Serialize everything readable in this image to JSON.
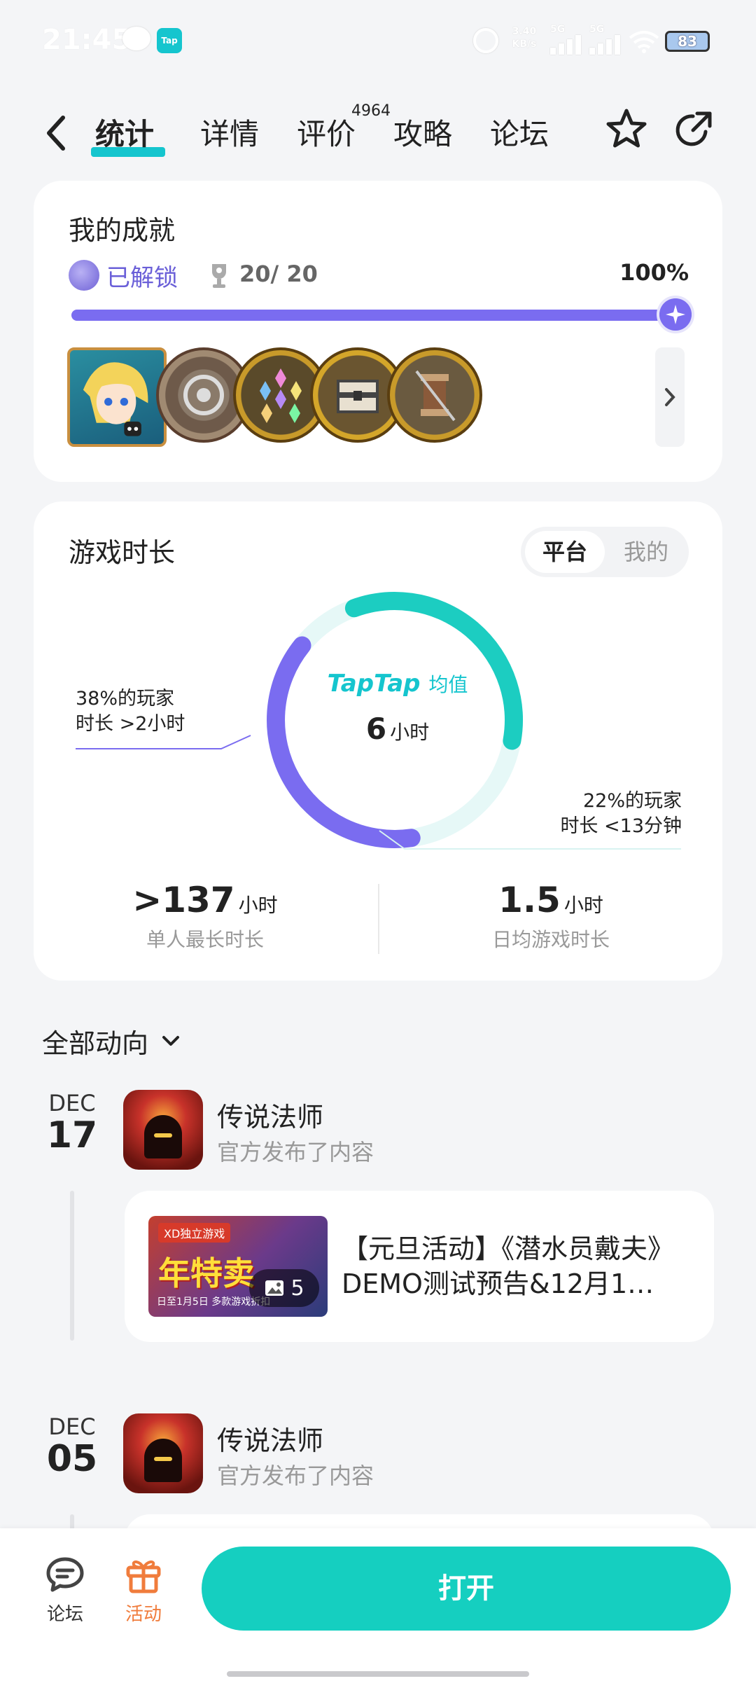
{
  "status_bar": {
    "time": "21:45",
    "tap_label": "Tap",
    "net_speed": "3.40",
    "net_unit": "KB/s",
    "signal1_label": "5G",
    "signal2_label": "5G",
    "battery": "83"
  },
  "nav": {
    "tabs": [
      {
        "label": "统计",
        "active": true
      },
      {
        "label": "详情"
      },
      {
        "label": "评价"
      },
      {
        "label": "攻略"
      },
      {
        "label": "论坛"
      }
    ],
    "review_count": "4964"
  },
  "achievements": {
    "title": "我的成就",
    "status_label": "已解锁",
    "count": "20/ 20",
    "percent_text": "100%",
    "progress": 1.0,
    "accent_color": "#7a6cf0"
  },
  "play_time": {
    "title": "游戏时长",
    "toggle": {
      "active": "平台",
      "inactive": "我的"
    },
    "brand": "TapTap",
    "brand_suffix": "均值",
    "avg_value": "6",
    "avg_unit": "小时",
    "left_note": [
      "38%的玩家",
      "时长 >2小时"
    ],
    "right_note": [
      "22%的玩家",
      "时长 <13分钟"
    ],
    "ring_over_2h_share": 0.38,
    "ring_under_13min_share": 0.22,
    "stats": [
      {
        "value": ">137",
        "unit": "小时",
        "label": "单人最长时长"
      },
      {
        "value": "1.5",
        "unit": "小时",
        "label": "日均游戏时长"
      }
    ]
  },
  "feed": {
    "filter_label": "全部动向",
    "entries": [
      {
        "month": "DEC",
        "day": "17",
        "name": "传说法师",
        "subtitle": "官方发布了内容",
        "post": {
          "thumb_tag": "XD独立游戏",
          "thumb_text": "年特卖",
          "thumb_small": "日至1月5日 多款游戏折扣",
          "image_count": "5",
          "title_line1": "【元旦活动】《潜水员戴夫》",
          "title_line2": "DEMO测试预告&12月1…"
        }
      },
      {
        "month": "DEC",
        "day": "05",
        "name": "传说法师",
        "subtitle": "官方发布了内容"
      }
    ]
  },
  "bottom_bar": {
    "forum_label": "论坛",
    "event_label": "活动",
    "open_label": "打开"
  }
}
